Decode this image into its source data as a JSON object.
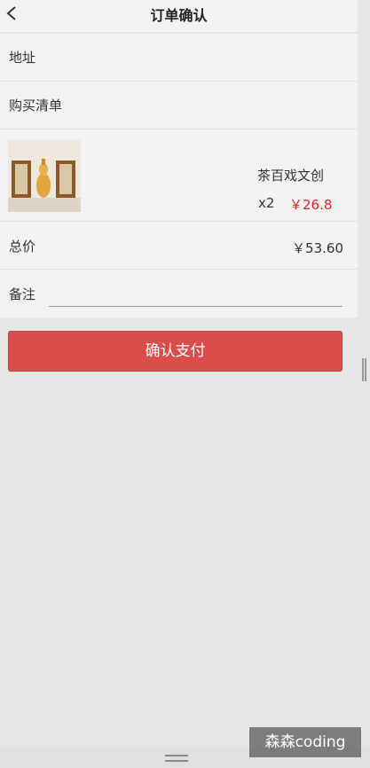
{
  "header": {
    "title": "订单确认",
    "back_icon": "chevron-left-icon"
  },
  "address": {
    "label": "地址"
  },
  "shopping_list": {
    "label": "购买清单"
  },
  "product": {
    "name": "茶百戏文创",
    "quantity": "x2",
    "price": "￥26.8",
    "price_color": "#d9242b"
  },
  "total": {
    "label": "总价",
    "value": "￥53.60"
  },
  "note": {
    "label": "备注",
    "value": ""
  },
  "pay_button": {
    "label": "确认支付",
    "color": "#da4d4a"
  },
  "watermark": {
    "text": "森森coding"
  }
}
